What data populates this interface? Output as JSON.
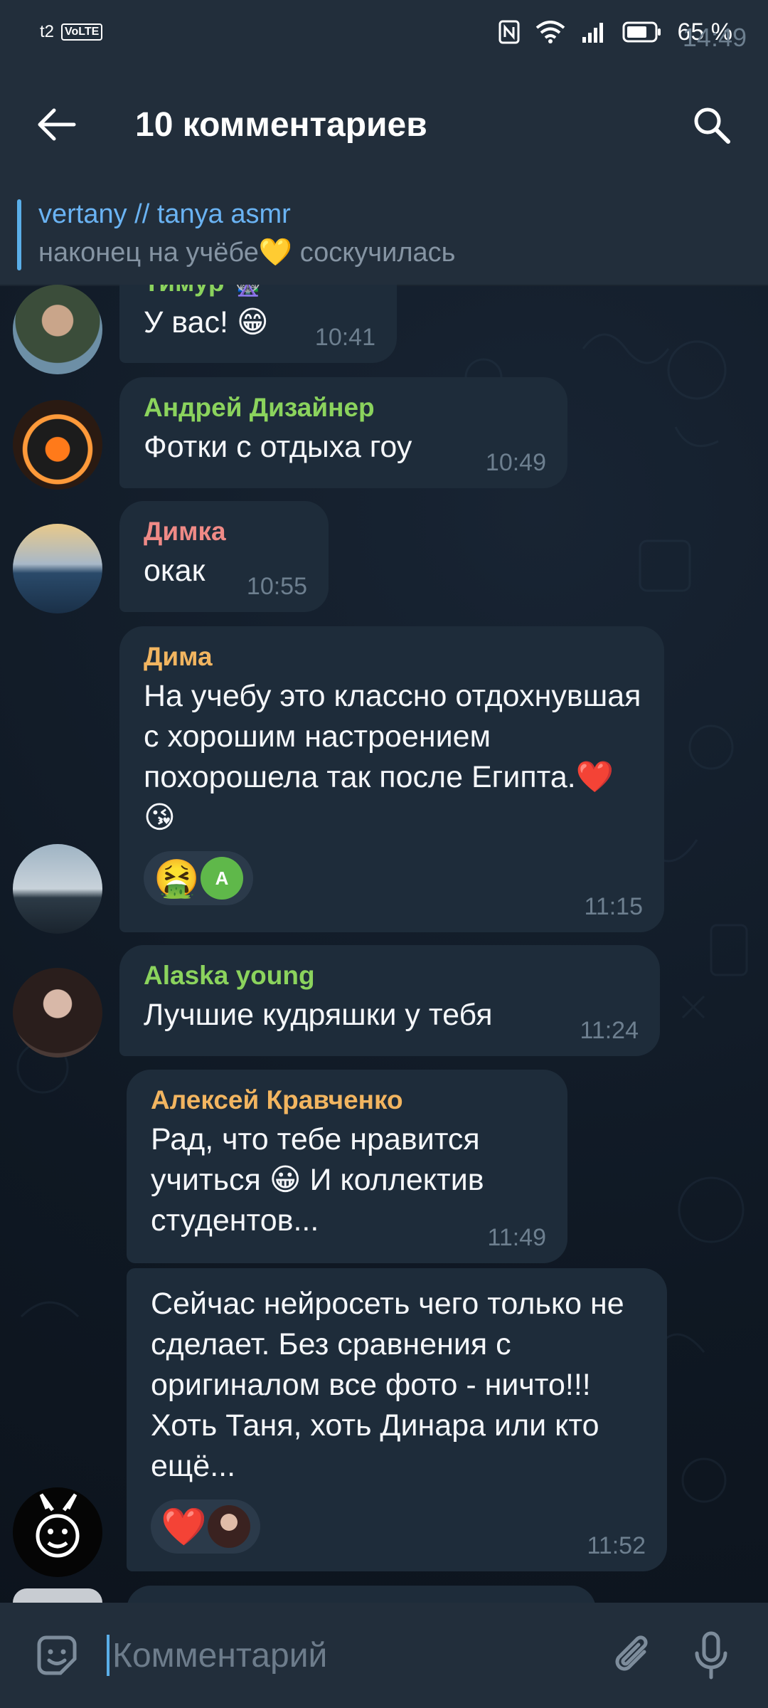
{
  "status": {
    "carrier": "t2",
    "volte": "VoLTE",
    "time": "14:49",
    "battery": "65 %"
  },
  "header": {
    "title": "10 комментариев"
  },
  "pinned": {
    "channel": "vertany // tanya asmr",
    "text": "наконец на учёбе💛 соскучилась"
  },
  "messages": [
    {
      "sender": "Тимур 🎡",
      "sender_color": "#8bd35d",
      "text": "У вас! 😁",
      "time": "10:41"
    },
    {
      "sender": "Андрей Дизайнер",
      "sender_color": "#8bd35d",
      "text": "Фотки с отдыха гоу",
      "time": "10:49"
    },
    {
      "sender": "Димка",
      "sender_color": "#ef8a86",
      "text": "окак",
      "time": "10:55"
    },
    {
      "sender": "Дима",
      "sender_color": "#f2b560",
      "text": "На учебу это классно отдохнувшая с хорошим настроением похорошела так после Египта.❤️😘",
      "time": "11:15",
      "reactions": [
        {
          "emoji": "🤮",
          "user_initial": "A"
        }
      ]
    },
    {
      "sender": "Alaska young",
      "sender_color": "#8bd35d",
      "text": "Лучшие кудряшки у тебя",
      "time": "11:24"
    },
    {
      "sender": "Алексей Кравченко",
      "sender_color": "#f2b560",
      "text": "Рад, что тебе нравится учиться 😀 И коллектив студентов...",
      "time": "11:49"
    },
    {
      "sender": "",
      "text": "Сейчас нейросеть чего только не сделает. Без сравнения с оригиналом все фото - ничто!!! Хоть Таня, хоть Динара или кто ещё...",
      "time": "11:52",
      "reactions": [
        {
          "emoji": "❤️",
          "user_initial": ""
        }
      ]
    }
  ],
  "composer": {
    "placeholder": "Комментарий"
  },
  "colors": {
    "accent": "#5aaee8",
    "bubble": "#1e2c3a",
    "header": "#222e3b"
  }
}
